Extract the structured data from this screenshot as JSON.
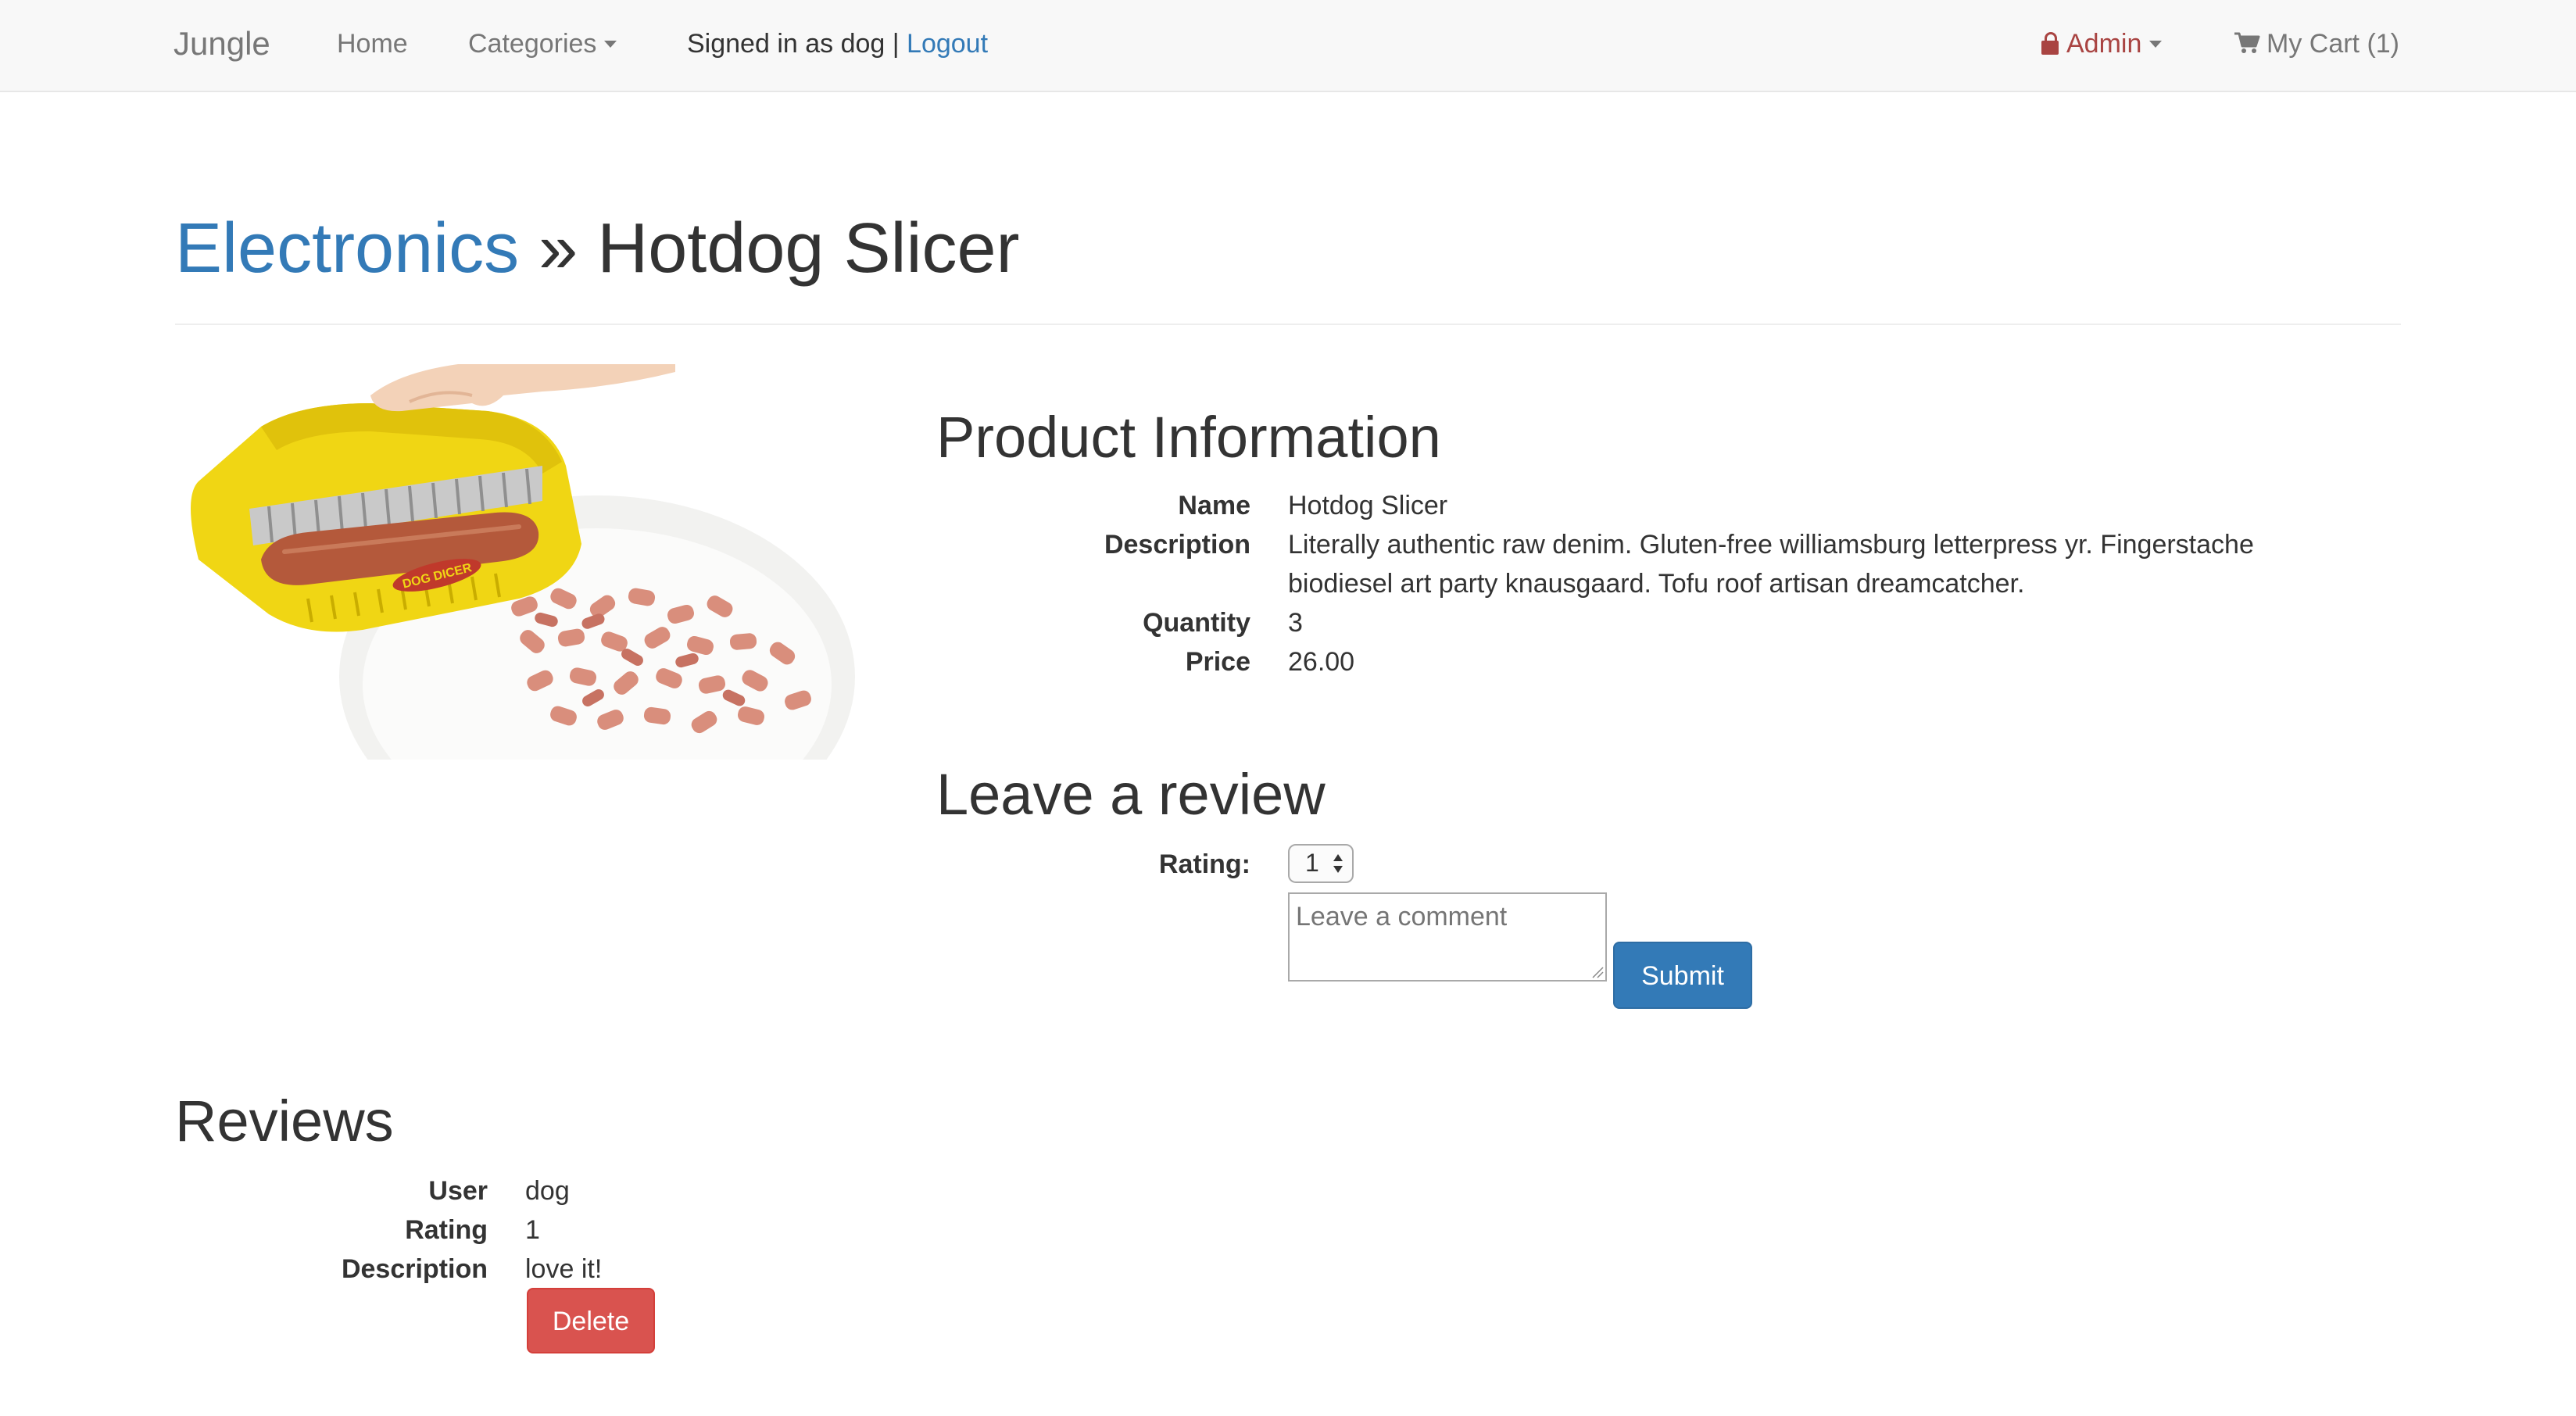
{
  "navbar": {
    "brand": "Jungle",
    "home": "Home",
    "categories": "Categories",
    "signed_in_text": "Signed in as dog |",
    "logout": "Logout",
    "admin": "Admin",
    "cart": "My Cart (1)"
  },
  "header": {
    "category": "Electronics",
    "separator": "»",
    "product_name": "Hotdog Slicer"
  },
  "product_image": {
    "icon": "hotdog-slicer-product-photo",
    "label": "DOG DICER"
  },
  "product_info": {
    "heading": "Product Information",
    "name_label": "Name",
    "name": "Hotdog Slicer",
    "description_label": "Description",
    "description_line1": "Literally authentic raw denim. Gluten-free williamsburg letterpress yr. Fingerstache",
    "description_line2": "biodiesel art party knausgaard. Tofu roof artisan dreamcatcher.",
    "quantity_label": "Quantity",
    "quantity": "3",
    "price_label": "Price",
    "price": "26.00"
  },
  "review_form": {
    "heading": "Leave a review",
    "rating_label": "Rating:",
    "rating_value": "1",
    "comment_placeholder": "Leave a comment",
    "submit": "Submit"
  },
  "reviews": {
    "heading": "Reviews",
    "user_label": "User",
    "user": "dog",
    "rating_label": "Rating",
    "rating": "1",
    "description_label": "Description",
    "description": "love it!",
    "delete": "Delete"
  },
  "colors": {
    "link": "#337ab7",
    "admin": "#a94442",
    "primary_button": "#337ab7",
    "danger_button": "#d9534f",
    "navbar_bg": "#f8f8f8"
  }
}
